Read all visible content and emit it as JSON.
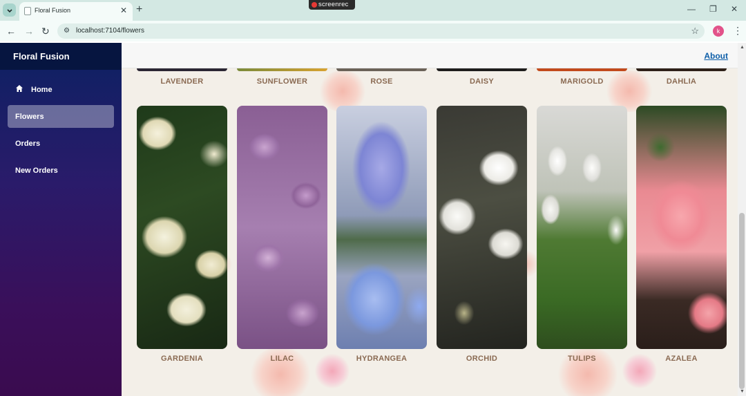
{
  "browser": {
    "tab_title": "Floral Fusion",
    "new_tab": "+",
    "tab_close": "✕",
    "url": "localhost:7104/flowers",
    "profile_initial": "k",
    "recorder_label": "screenrec",
    "icons": [
      "tab-search-icon",
      "back-icon",
      "forward-icon",
      "reload-icon",
      "site-info-icon",
      "star-icon",
      "menu-icon",
      "minimize-icon",
      "maximize-icon",
      "close-icon"
    ]
  },
  "sidebar": {
    "brand": "Floral Fusion",
    "items": [
      {
        "label": "Home",
        "icon": "home-icon",
        "active": false
      },
      {
        "label": "Flowers",
        "active": true
      },
      {
        "label": "Orders",
        "active": false
      },
      {
        "label": "New Orders",
        "active": false
      }
    ]
  },
  "header": {
    "about_link": "About"
  },
  "flowers_top_row": [
    "LAVENDER",
    "SUNFLOWER",
    "ROSE",
    "DAISY",
    "MARIGOLD",
    "DAHLIA"
  ],
  "flowers_bottom_row": [
    "GARDENIA",
    "LILAC",
    "HYDRANGEA",
    "ORCHID",
    "TULIPS",
    "AZALEA"
  ],
  "colors": {
    "sidebar_top": "#0c2163",
    "sidebar_bottom": "#3a0b4f",
    "brand_bar": "#061540",
    "label_color": "#8a6a52",
    "link_color": "#0d5ea8",
    "chrome_bg": "#d3e8e3"
  }
}
